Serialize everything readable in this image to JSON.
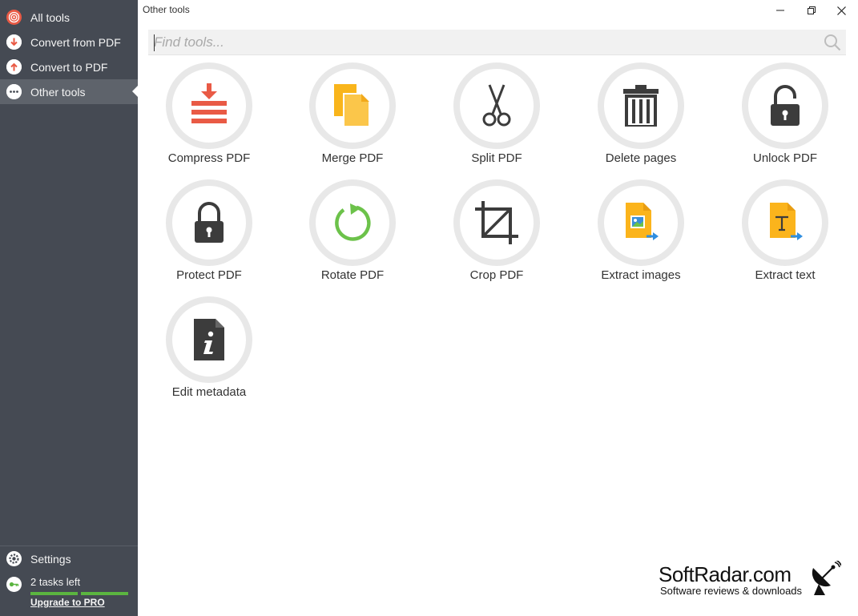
{
  "window": {
    "title": "Other tools"
  },
  "sidebar": {
    "items": [
      {
        "label": "All tools",
        "icon": "target-icon"
      },
      {
        "label": "Convert from PDF",
        "icon": "arrow-down-icon"
      },
      {
        "label": "Convert to PDF",
        "icon": "arrow-up-icon"
      },
      {
        "label": "Other tools",
        "icon": "more-icon",
        "active": true
      }
    ],
    "settings_label": "Settings",
    "tasks_label": "2 tasks left",
    "upgrade_label": "Upgrade to PRO"
  },
  "search": {
    "placeholder": "Find tools...",
    "value": ""
  },
  "tools": [
    {
      "label": "Compress PDF",
      "icon": "compress-icon"
    },
    {
      "label": "Merge PDF",
      "icon": "merge-icon"
    },
    {
      "label": "Split PDF",
      "icon": "scissors-icon"
    },
    {
      "label": "Delete pages",
      "icon": "trash-icon"
    },
    {
      "label": "Unlock PDF",
      "icon": "unlock-icon"
    },
    {
      "label": "Protect PDF",
      "icon": "lock-icon"
    },
    {
      "label": "Rotate PDF",
      "icon": "rotate-icon"
    },
    {
      "label": "Crop PDF",
      "icon": "crop-icon"
    },
    {
      "label": "Extract images",
      "icon": "extract-images-icon"
    },
    {
      "label": "Extract text",
      "icon": "extract-text-icon"
    },
    {
      "label": "Edit metadata",
      "icon": "info-document-icon"
    }
  ],
  "watermark": {
    "brand": "SoftRadar.com",
    "tagline": "Software reviews & downloads"
  },
  "colors": {
    "sidebar": "#454a53",
    "sidebar_active": "#5e636b",
    "accent_red": "#e95a45",
    "accent_yellow": "#fbb41c",
    "accent_green": "#6cc24a",
    "dark_icon": "#3c3c3c"
  }
}
